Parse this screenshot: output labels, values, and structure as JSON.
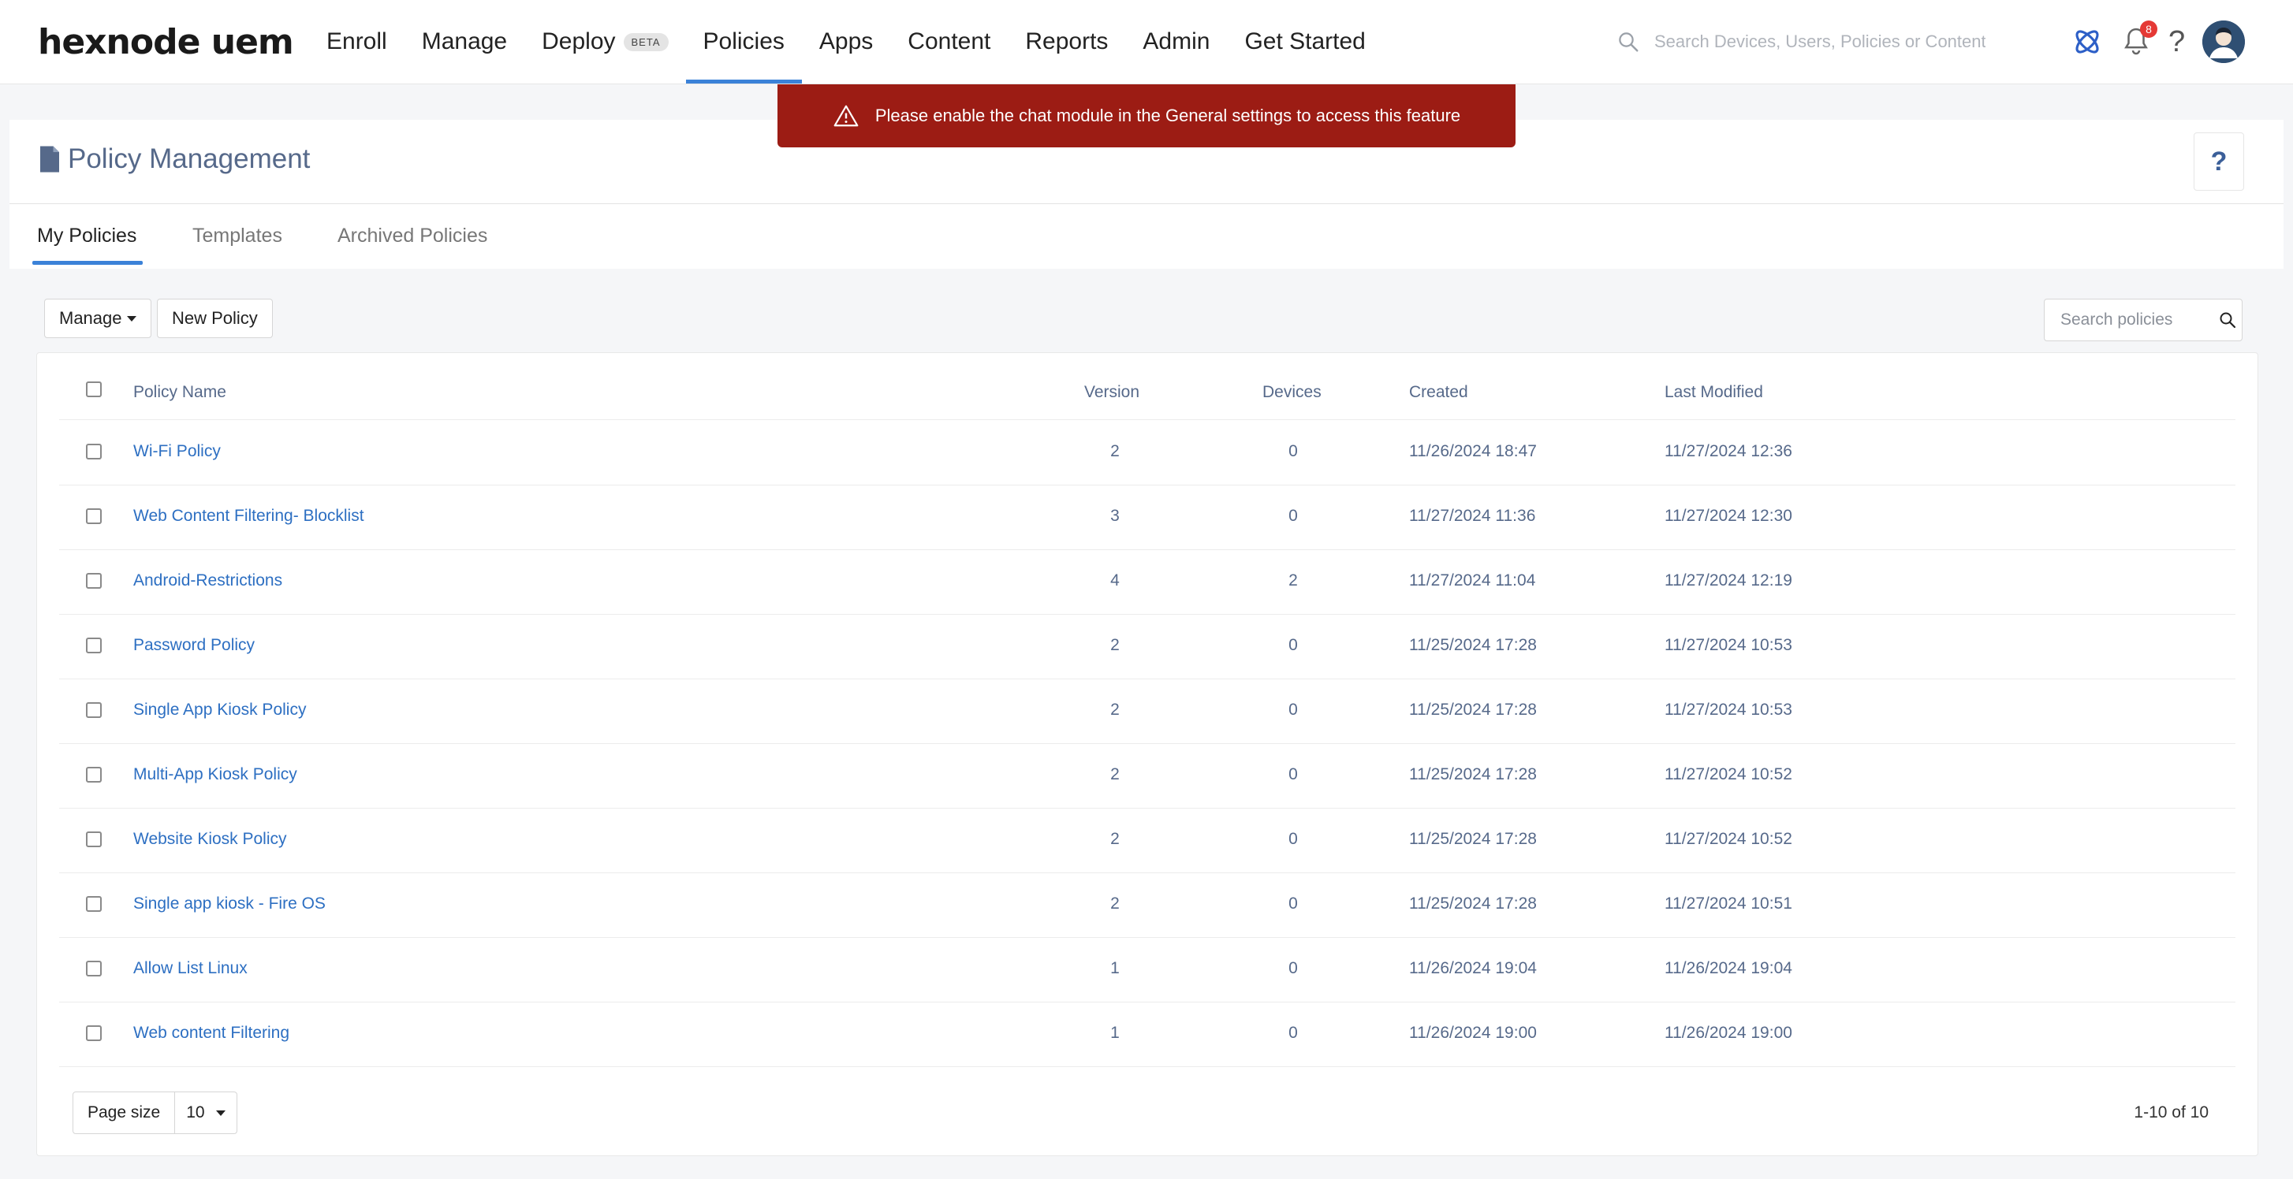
{
  "app": {
    "logo": "hexnode uem"
  },
  "nav": {
    "items": [
      {
        "label": "Enroll"
      },
      {
        "label": "Manage"
      },
      {
        "label": "Deploy",
        "badge": "BETA"
      },
      {
        "label": "Policies",
        "active": true
      },
      {
        "label": "Apps"
      },
      {
        "label": "Content"
      },
      {
        "label": "Reports"
      },
      {
        "label": "Admin"
      },
      {
        "label": "Get Started"
      }
    ],
    "search_placeholder": "Search Devices, Users, Policies or Content",
    "notification_count": "8",
    "help_label": "?"
  },
  "alert": {
    "message": "Please enable the chat module in the General settings to access this feature",
    "color": "#9c1c14"
  },
  "page": {
    "title": "Policy Management",
    "help_label": "?"
  },
  "tabs": [
    {
      "label": "My Policies",
      "active": true
    },
    {
      "label": "Templates"
    },
    {
      "label": "Archived Policies"
    }
  ],
  "toolbar": {
    "manage_label": "Manage",
    "new_policy_label": "New Policy",
    "search_placeholder": "Search policies"
  },
  "table": {
    "headers": {
      "name": "Policy Name",
      "version": "Version",
      "devices": "Devices",
      "created": "Created",
      "modified": "Last Modified"
    },
    "rows": [
      {
        "name": "Wi-Fi Policy",
        "version": "2",
        "devices": "0",
        "created": "11/26/2024 18:47",
        "modified": "11/27/2024 12:36"
      },
      {
        "name": "Web Content Filtering- Blocklist",
        "version": "3",
        "devices": "0",
        "created": "11/27/2024 11:36",
        "modified": "11/27/2024 12:30"
      },
      {
        "name": "Android-Restrictions",
        "version": "4",
        "devices": "2",
        "created": "11/27/2024 11:04",
        "modified": "11/27/2024 12:19"
      },
      {
        "name": "Password Policy",
        "version": "2",
        "devices": "0",
        "created": "11/25/2024 17:28",
        "modified": "11/27/2024 10:53"
      },
      {
        "name": "Single App Kiosk Policy",
        "version": "2",
        "devices": "0",
        "created": "11/25/2024 17:28",
        "modified": "11/27/2024 10:53"
      },
      {
        "name": "Multi-App Kiosk Policy",
        "version": "2",
        "devices": "0",
        "created": "11/25/2024 17:28",
        "modified": "11/27/2024 10:52"
      },
      {
        "name": "Website Kiosk Policy",
        "version": "2",
        "devices": "0",
        "created": "11/25/2024 17:28",
        "modified": "11/27/2024 10:52"
      },
      {
        "name": "Single app kiosk - Fire OS",
        "version": "2",
        "devices": "0",
        "created": "11/25/2024 17:28",
        "modified": "11/27/2024 10:51"
      },
      {
        "name": "Allow List Linux",
        "version": "1",
        "devices": "0",
        "created": "11/26/2024 19:04",
        "modified": "11/26/2024 19:04"
      },
      {
        "name": "Web content Filtering",
        "version": "1",
        "devices": "0",
        "created": "11/26/2024 19:00",
        "modified": "11/26/2024 19:00"
      }
    ]
  },
  "footer": {
    "page_size_label": "Page size",
    "page_size_value": "10",
    "pagination_text": "1-10 of 10"
  }
}
